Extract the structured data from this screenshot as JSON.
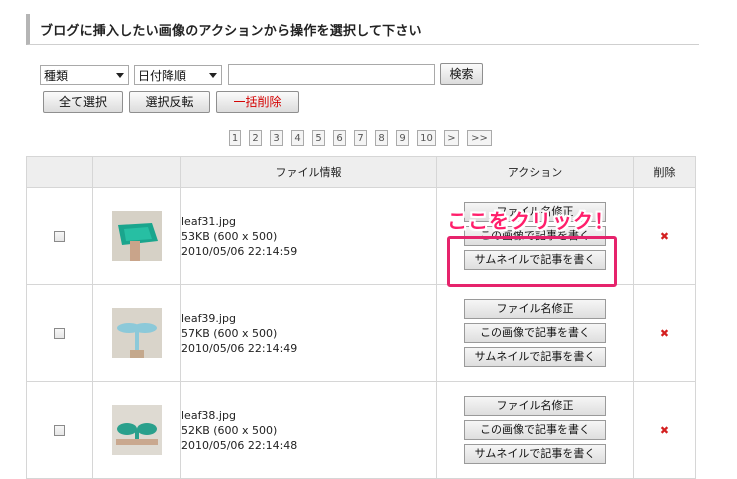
{
  "header": {
    "title": "ブログに挿入したい画像のアクションから操作を選択して下さい"
  },
  "filters": {
    "type_select": "種類",
    "sort_select": "日付降順",
    "search_value": "",
    "search_button": "検索"
  },
  "bulk": {
    "select_all": "全て選択",
    "invert": "選択反転",
    "delete_all": "一括削除"
  },
  "pager": [
    "1",
    "2",
    "3",
    "4",
    "5",
    "6",
    "7",
    "8",
    "9",
    "10",
    ">",
    ">>"
  ],
  "table": {
    "columns": [
      "",
      "",
      "ファイル情報",
      "アクション",
      "削除"
    ],
    "rows": [
      {
        "filename": "leaf31.jpg",
        "size": "53KB (600 x 500)",
        "date": "2010/05/06 22:14:59",
        "thumb_icon": "leaf-photo-1"
      },
      {
        "filename": "leaf39.jpg",
        "size": "57KB (600 x 500)",
        "date": "2010/05/06 22:14:49",
        "thumb_icon": "leaf-photo-2"
      },
      {
        "filename": "leaf38.jpg",
        "size": "52KB (600 x 500)",
        "date": "2010/05/06 22:14:48",
        "thumb_icon": "leaf-photo-3"
      }
    ],
    "actions": {
      "rename": "ファイル名修正",
      "write_with_image": "この画像で記事を書く",
      "write_with_thumb": "サムネイルで記事を書く"
    },
    "delete_icon": "✖"
  },
  "annotation": {
    "callout": "ここをクリック！",
    "color": "#e6236c"
  }
}
